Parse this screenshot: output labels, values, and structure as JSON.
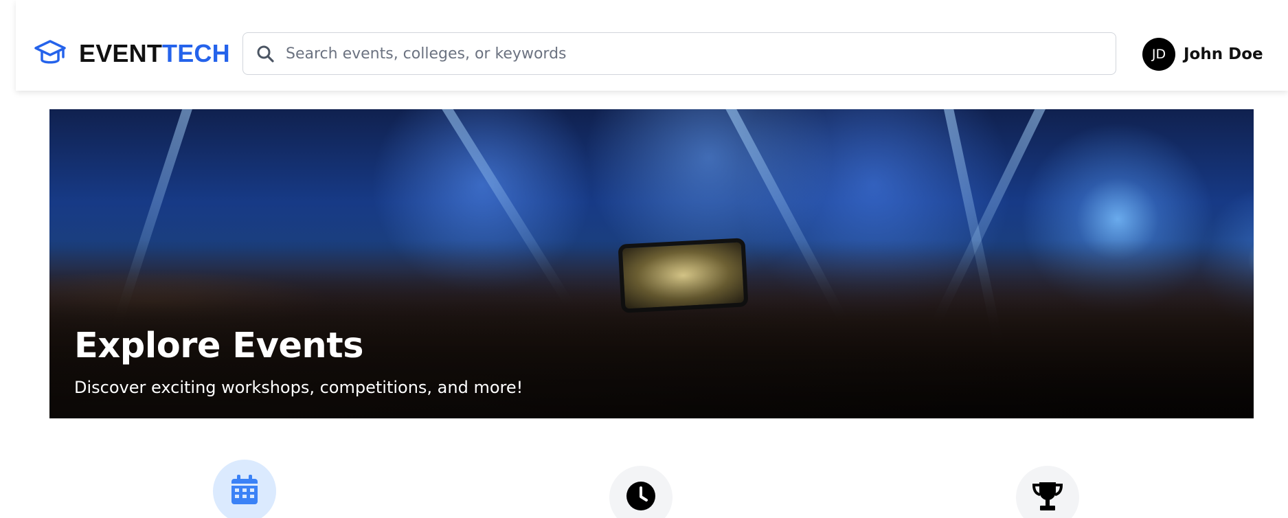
{
  "header": {
    "logo": {
      "icon": "graduation-cap-icon",
      "text_part1": "EVENT",
      "text_part2": "TECH",
      "accent_color": "#2563eb"
    },
    "search": {
      "icon": "search-icon",
      "placeholder": "Search events, colleges, or keywords",
      "value": ""
    },
    "user": {
      "avatar_initials": "JD",
      "name": "John Doe"
    }
  },
  "hero": {
    "title": "Explore Events",
    "subtitle": "Discover exciting workshops, competitions, and more!"
  },
  "features": [
    {
      "icon": "calendar-icon",
      "color": "#2563eb",
      "background": "#dbeafe"
    },
    {
      "icon": "clock-icon",
      "color": "#000000",
      "background": "#f3f4f6"
    },
    {
      "icon": "trophy-icon",
      "color": "#000000",
      "background": "#f3f4f6"
    }
  ]
}
